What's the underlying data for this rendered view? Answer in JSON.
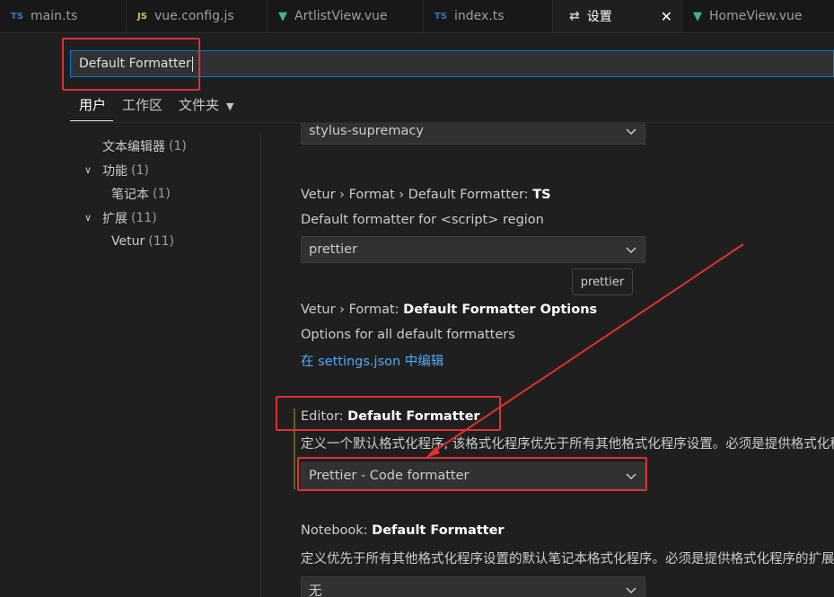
{
  "tabs": [
    {
      "icon": "TS",
      "label": "main.ts"
    },
    {
      "icon": "JS",
      "label": "vue.config.js"
    },
    {
      "icon": "V",
      "label": "ArtlistView.vue"
    },
    {
      "icon": "TS",
      "label": "index.ts"
    },
    {
      "icon": "gear",
      "label": "设置"
    },
    {
      "icon": "V",
      "label": "HomeView.vue"
    }
  ],
  "search": {
    "value": "Default Formatter"
  },
  "scopes": {
    "user": "用户",
    "workspace": "工作区",
    "folder": "文件夹"
  },
  "tree": [
    {
      "label": "文本编辑器",
      "count": "(1)"
    },
    {
      "label": "功能",
      "count": "(1)"
    },
    {
      "label": "笔记本",
      "count": "(1)"
    },
    {
      "label": "扩展",
      "count": "(11)"
    },
    {
      "label": "Vetur",
      "count": "(11)"
    }
  ],
  "settings": {
    "stylus_value": "stylus-supremacy",
    "ts": {
      "prefix": "Vetur › Format › Default Formatter: ",
      "name": "TS",
      "desc": "Default formatter for <script> region",
      "value": "prettier",
      "tooltip": "prettier"
    },
    "options": {
      "prefix": "Vetur › Format: ",
      "name": "Default Formatter Options",
      "desc": "Options for all default formatters",
      "link": "在 settings.json 中编辑"
    },
    "editor": {
      "prefix": "Editor: ",
      "name": "Default Formatter",
      "desc": "定义一个默认格式化程序, 该格式化程序优先于所有其他格式化程序设置。必须是提供格式化程序的扩展的标识符。",
      "value": "Prettier - Code formatter"
    },
    "notebook": {
      "prefix": "Notebook: ",
      "name": "Default Formatter",
      "desc": "定义优先于所有其他格式化程序设置的默认笔记本格式化程序。必须是提供格式化程序的扩展的标识符。",
      "value": "无"
    }
  },
  "colors": {
    "accent": "#0078d4",
    "annotation": "#e03030",
    "link": "#4daafc"
  }
}
